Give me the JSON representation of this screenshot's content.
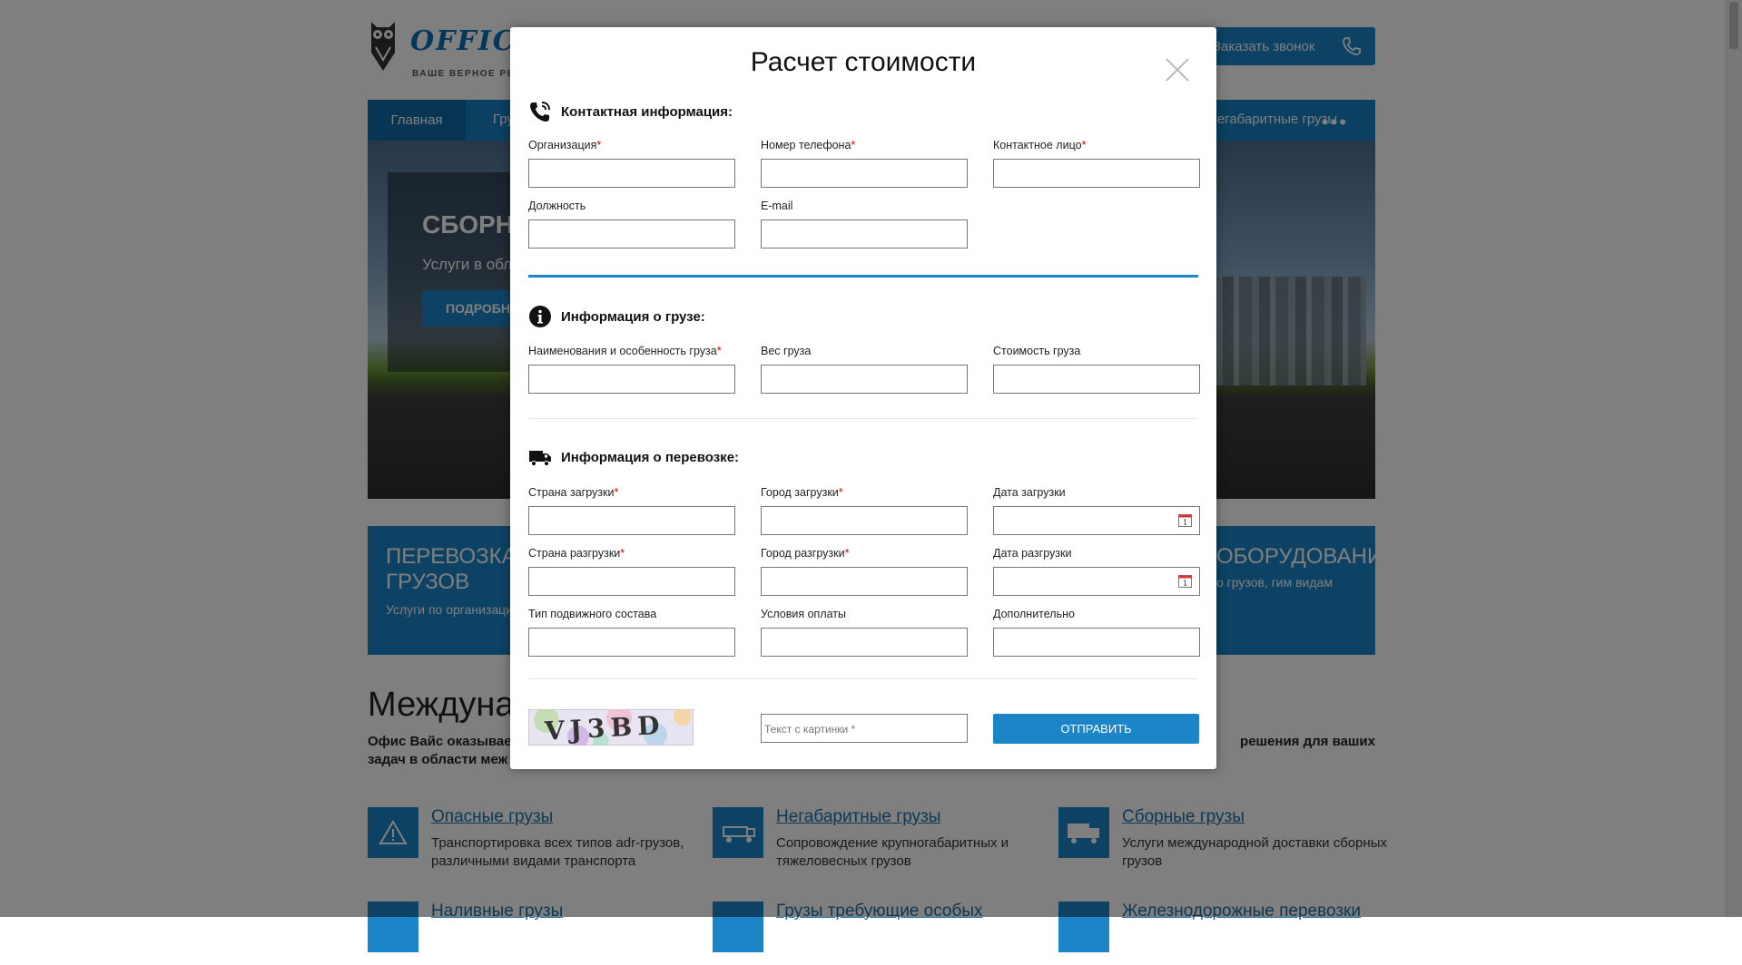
{
  "background": {
    "logo": {
      "brand": "OFFICE WISE",
      "tagline": "ВАШЕ ВЕРНОЕ РЕШЕНИЕ"
    },
    "callback_label": "Заказать звонок",
    "nav": {
      "items": [
        "Главная",
        "Грузы",
        "Негабаритные грузы"
      ],
      "more": "•••"
    },
    "hero": {
      "title": "СБОРНЫЕ ГРУЗЫ",
      "subtitle": "Услуги в области доставки",
      "button": "ПОДРОБНЕЕ"
    },
    "promo1": {
      "title": "ПЕРЕВОЗКА НАЛИВНЫХ ГРУЗОВ",
      "desc": "Услуги по организации доставки наливных грузов"
    },
    "promo2": {
      "title": "ОБОРУДОВАНИЯ",
      "desc": "о грузов, гим видам"
    },
    "heading": "Международные перевозки",
    "intro_left": "Офис Вайс оказывает",
    "intro_left2": "задач в области меж",
    "intro_right": "решения для ваших",
    "services": [
      {
        "title": "Опасные грузы",
        "desc": "Транспортировка всех типов adr-грузов, различными видами транспорта"
      },
      {
        "title": "Негабаритные грузы",
        "desc": "Сопровождение крупногабаритных и тяжеловесных грузов"
      },
      {
        "title": "Сборные грузы",
        "desc": "Услуги международной доставки сборных грузов"
      },
      {
        "title": "Наливные грузы",
        "desc": ""
      },
      {
        "title": "Грузы требующие особых",
        "desc": ""
      },
      {
        "title": "Железнодорожные перевозки",
        "desc": ""
      }
    ]
  },
  "modal": {
    "title": "Расчет стоимости",
    "sections": {
      "contact": "Контактная информация:",
      "cargo": "Информация о грузе:",
      "transport": "Информация о перевозке:"
    },
    "fields": {
      "org": "Организация",
      "phone": "Номер телефона",
      "contact_person": "Контактное лицо",
      "position": "Должность",
      "email": "E-mail",
      "cargo_name": "Наименования и особенность груза",
      "cargo_weight": "Вес груза",
      "cargo_cost": "Стоимость груза",
      "load_country": "Страна загрузки",
      "load_city": "Город загрузки",
      "load_date": "Дата загрузки",
      "unload_country": "Страна разгрузки",
      "unload_city": "Город разгрузки",
      "unload_date": "Дата разгрузки",
      "rolling_stock": "Тип подвижного состава",
      "payment": "Условия оплаты",
      "extra": "Дополнительно"
    },
    "required_mark": "*",
    "captcha_text": "VJ3BD",
    "captcha_placeholder": "Текст с картинки *",
    "submit": "ОТПРАВИТЬ"
  },
  "colors": {
    "accent": "#1b85c8",
    "required": "#dd0000",
    "overlay": "rgba(0,0,0,0.5)"
  },
  "icons": [
    "phone-icon",
    "info-icon",
    "truck-icon",
    "close-icon",
    "calendar-icon",
    "owl-logo-icon",
    "warning-icon"
  ]
}
